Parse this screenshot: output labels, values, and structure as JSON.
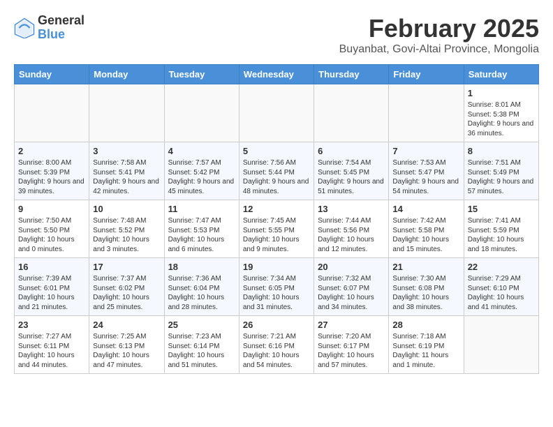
{
  "header": {
    "logo_general": "General",
    "logo_blue": "Blue",
    "month_title": "February 2025",
    "subtitle": "Buyanbat, Govi-Altai Province, Mongolia"
  },
  "weekdays": [
    "Sunday",
    "Monday",
    "Tuesday",
    "Wednesday",
    "Thursday",
    "Friday",
    "Saturday"
  ],
  "weeks": [
    [
      {
        "day": "",
        "info": ""
      },
      {
        "day": "",
        "info": ""
      },
      {
        "day": "",
        "info": ""
      },
      {
        "day": "",
        "info": ""
      },
      {
        "day": "",
        "info": ""
      },
      {
        "day": "",
        "info": ""
      },
      {
        "day": "1",
        "info": "Sunrise: 8:01 AM\nSunset: 5:38 PM\nDaylight: 9 hours and 36 minutes."
      }
    ],
    [
      {
        "day": "2",
        "info": "Sunrise: 8:00 AM\nSunset: 5:39 PM\nDaylight: 9 hours and 39 minutes."
      },
      {
        "day": "3",
        "info": "Sunrise: 7:58 AM\nSunset: 5:41 PM\nDaylight: 9 hours and 42 minutes."
      },
      {
        "day": "4",
        "info": "Sunrise: 7:57 AM\nSunset: 5:42 PM\nDaylight: 9 hours and 45 minutes."
      },
      {
        "day": "5",
        "info": "Sunrise: 7:56 AM\nSunset: 5:44 PM\nDaylight: 9 hours and 48 minutes."
      },
      {
        "day": "6",
        "info": "Sunrise: 7:54 AM\nSunset: 5:45 PM\nDaylight: 9 hours and 51 minutes."
      },
      {
        "day": "7",
        "info": "Sunrise: 7:53 AM\nSunset: 5:47 PM\nDaylight: 9 hours and 54 minutes."
      },
      {
        "day": "8",
        "info": "Sunrise: 7:51 AM\nSunset: 5:49 PM\nDaylight: 9 hours and 57 minutes."
      }
    ],
    [
      {
        "day": "9",
        "info": "Sunrise: 7:50 AM\nSunset: 5:50 PM\nDaylight: 10 hours and 0 minutes."
      },
      {
        "day": "10",
        "info": "Sunrise: 7:48 AM\nSunset: 5:52 PM\nDaylight: 10 hours and 3 minutes."
      },
      {
        "day": "11",
        "info": "Sunrise: 7:47 AM\nSunset: 5:53 PM\nDaylight: 10 hours and 6 minutes."
      },
      {
        "day": "12",
        "info": "Sunrise: 7:45 AM\nSunset: 5:55 PM\nDaylight: 10 hours and 9 minutes."
      },
      {
        "day": "13",
        "info": "Sunrise: 7:44 AM\nSunset: 5:56 PM\nDaylight: 10 hours and 12 minutes."
      },
      {
        "day": "14",
        "info": "Sunrise: 7:42 AM\nSunset: 5:58 PM\nDaylight: 10 hours and 15 minutes."
      },
      {
        "day": "15",
        "info": "Sunrise: 7:41 AM\nSunset: 5:59 PM\nDaylight: 10 hours and 18 minutes."
      }
    ],
    [
      {
        "day": "16",
        "info": "Sunrise: 7:39 AM\nSunset: 6:01 PM\nDaylight: 10 hours and 21 minutes."
      },
      {
        "day": "17",
        "info": "Sunrise: 7:37 AM\nSunset: 6:02 PM\nDaylight: 10 hours and 25 minutes."
      },
      {
        "day": "18",
        "info": "Sunrise: 7:36 AM\nSunset: 6:04 PM\nDaylight: 10 hours and 28 minutes."
      },
      {
        "day": "19",
        "info": "Sunrise: 7:34 AM\nSunset: 6:05 PM\nDaylight: 10 hours and 31 minutes."
      },
      {
        "day": "20",
        "info": "Sunrise: 7:32 AM\nSunset: 6:07 PM\nDaylight: 10 hours and 34 minutes."
      },
      {
        "day": "21",
        "info": "Sunrise: 7:30 AM\nSunset: 6:08 PM\nDaylight: 10 hours and 38 minutes."
      },
      {
        "day": "22",
        "info": "Sunrise: 7:29 AM\nSunset: 6:10 PM\nDaylight: 10 hours and 41 minutes."
      }
    ],
    [
      {
        "day": "23",
        "info": "Sunrise: 7:27 AM\nSunset: 6:11 PM\nDaylight: 10 hours and 44 minutes."
      },
      {
        "day": "24",
        "info": "Sunrise: 7:25 AM\nSunset: 6:13 PM\nDaylight: 10 hours and 47 minutes."
      },
      {
        "day": "25",
        "info": "Sunrise: 7:23 AM\nSunset: 6:14 PM\nDaylight: 10 hours and 51 minutes."
      },
      {
        "day": "26",
        "info": "Sunrise: 7:21 AM\nSunset: 6:16 PM\nDaylight: 10 hours and 54 minutes."
      },
      {
        "day": "27",
        "info": "Sunrise: 7:20 AM\nSunset: 6:17 PM\nDaylight: 10 hours and 57 minutes."
      },
      {
        "day": "28",
        "info": "Sunrise: 7:18 AM\nSunset: 6:19 PM\nDaylight: 11 hours and 1 minute."
      },
      {
        "day": "",
        "info": ""
      }
    ]
  ]
}
